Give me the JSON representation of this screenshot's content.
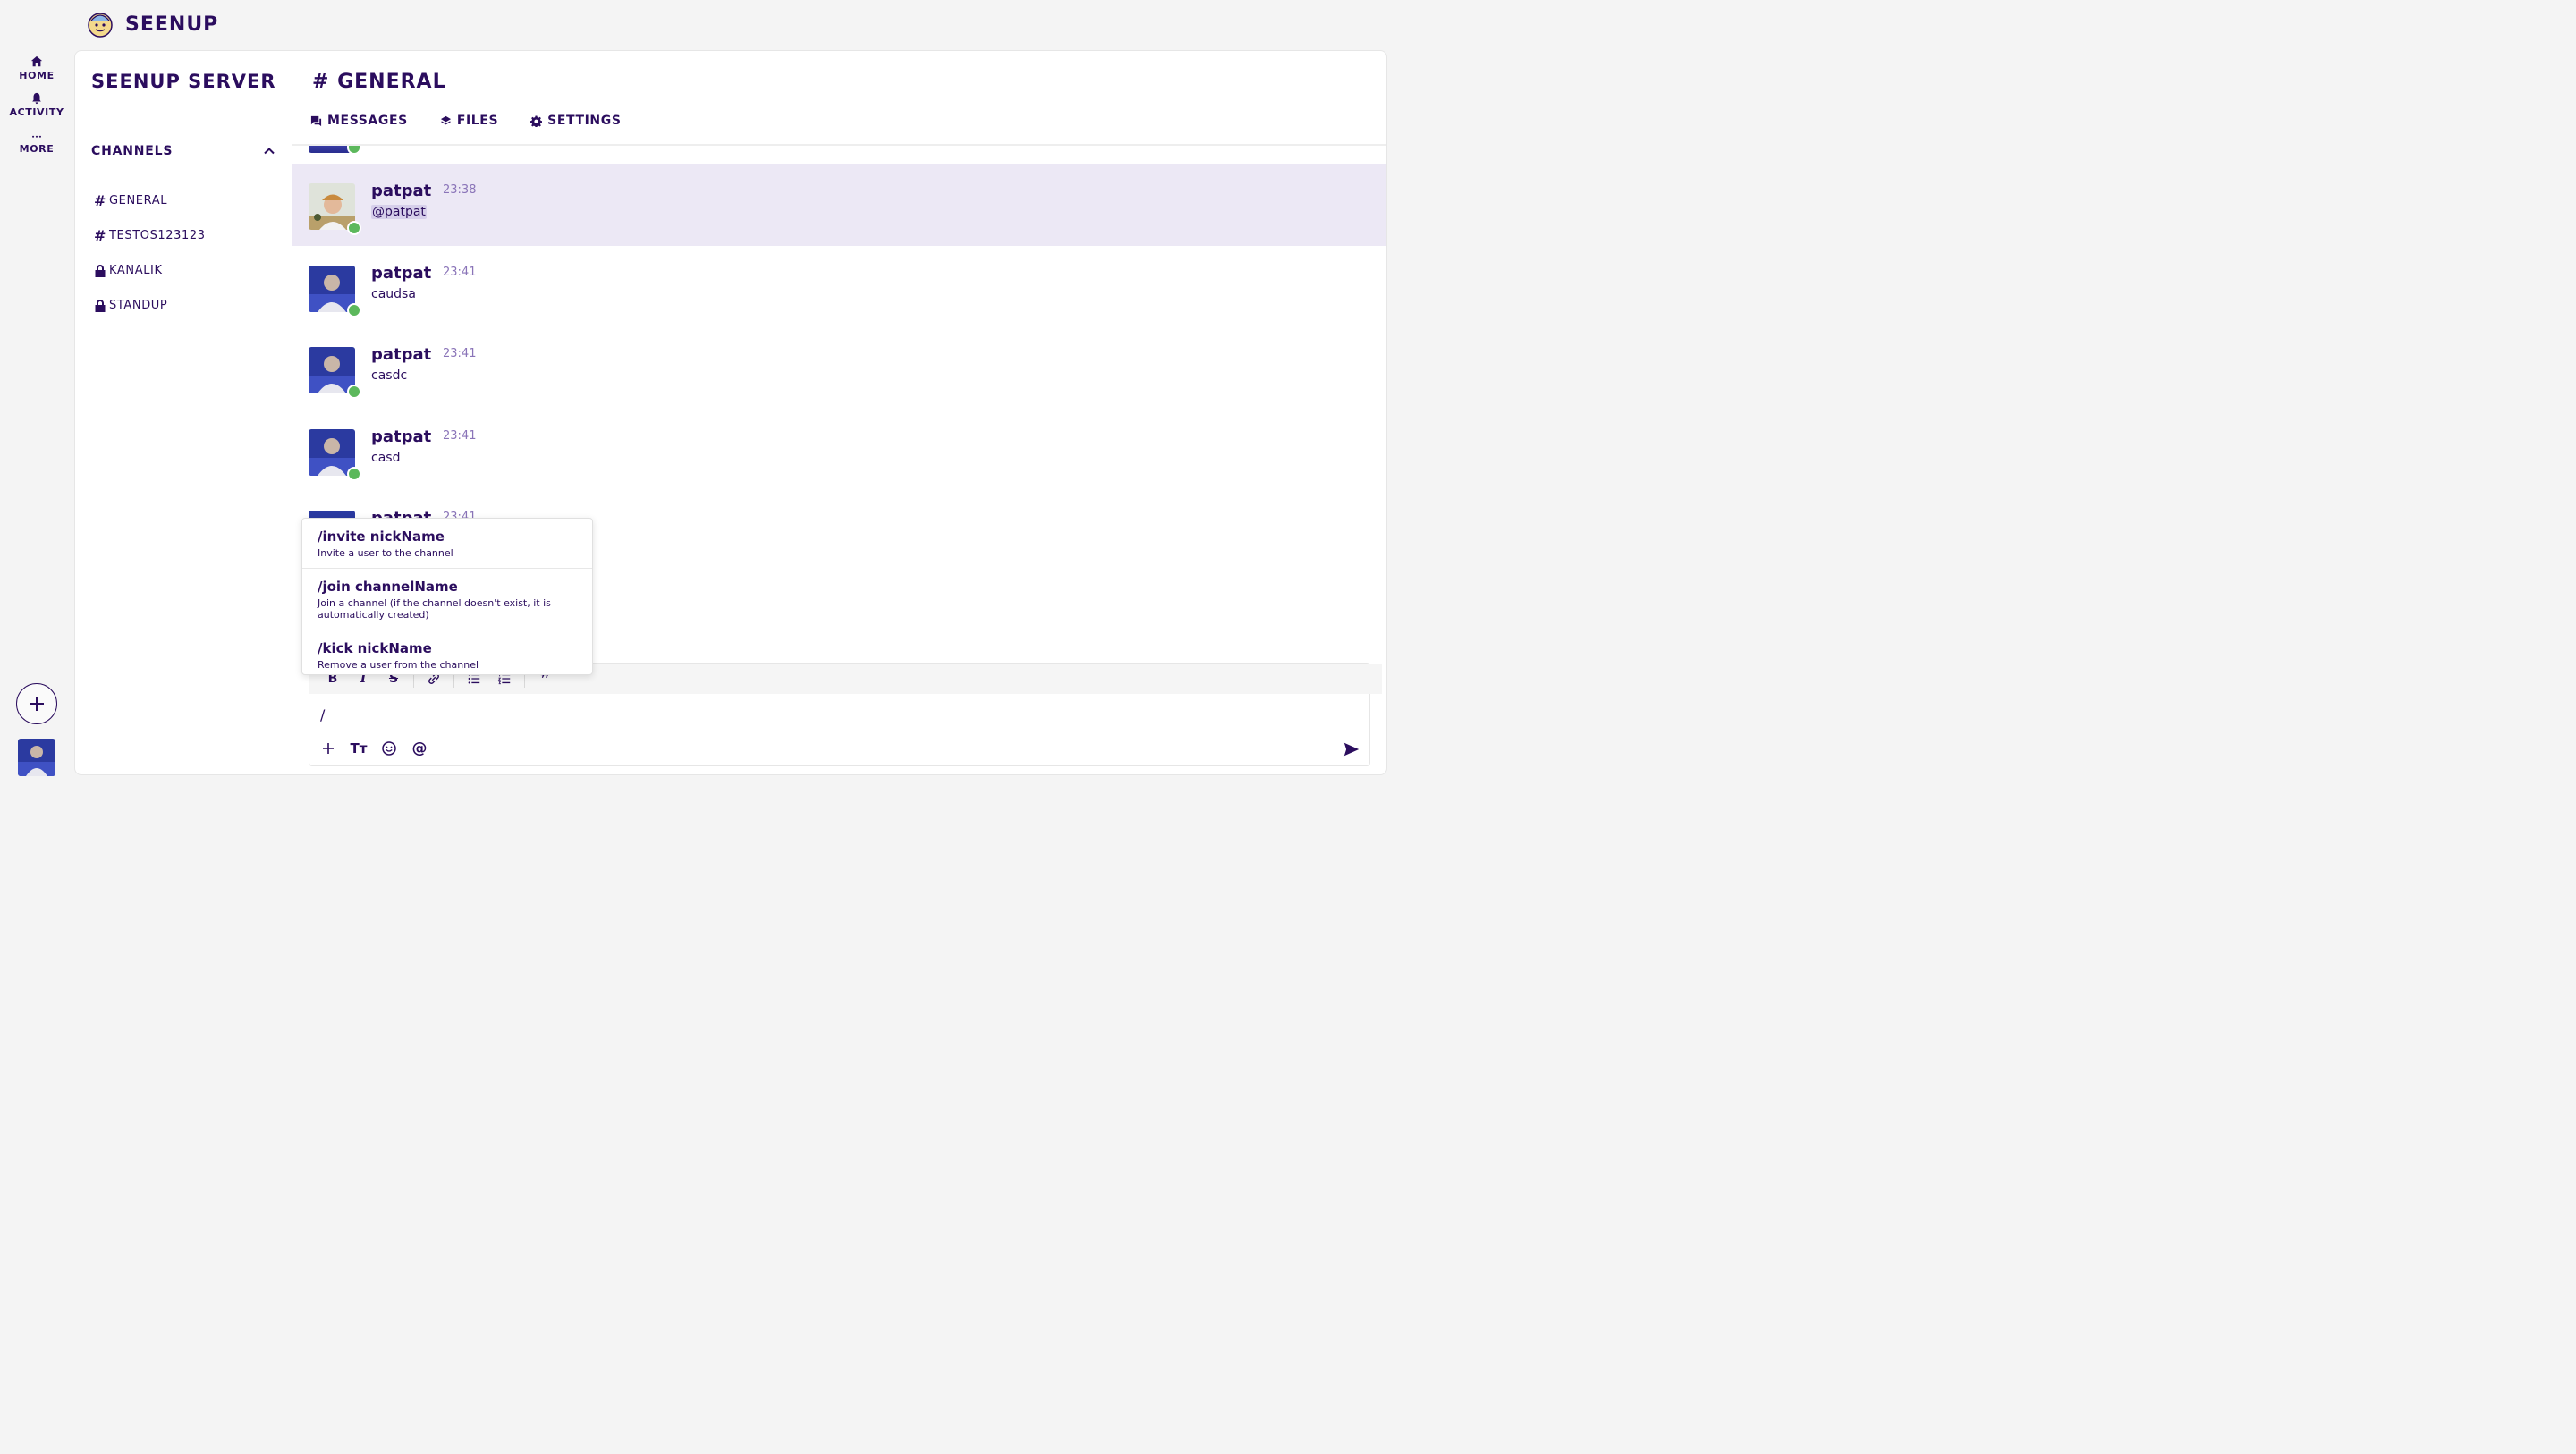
{
  "app": {
    "name": "SEENUP"
  },
  "rail": {
    "items": [
      {
        "label": "HOME",
        "icon": "home-icon"
      },
      {
        "label": "ACTIVITY",
        "icon": "bell-icon"
      },
      {
        "label": "MORE",
        "icon": "ellipsis-icon"
      }
    ]
  },
  "sidebar": {
    "server_name": "SEENUP SERVER",
    "channels_header": "CHANNELS",
    "channels": [
      {
        "name": "GENERAL",
        "type": "public"
      },
      {
        "name": "TESTOS123123",
        "type": "public"
      },
      {
        "name": "KANALIK",
        "type": "private"
      },
      {
        "name": "STANDUP",
        "type": "private"
      }
    ]
  },
  "main": {
    "channel_title": "GENERAL",
    "tabs": [
      {
        "label": "MESSAGES",
        "icon": "message-icon"
      },
      {
        "label": "FILES",
        "icon": "layers-icon"
      },
      {
        "label": "SETTINGS",
        "icon": "gear-icon"
      }
    ],
    "messages": [
      {
        "author": "patpat",
        "time": "23:38",
        "text": "@patpat",
        "highlight": true
      },
      {
        "author": "patpat",
        "time": "23:41",
        "text": "caudsa"
      },
      {
        "author": "patpat",
        "time": "23:41",
        "text": "casdc"
      },
      {
        "author": "patpat",
        "time": "23:41",
        "text": "casd"
      },
      {
        "author": "patpat",
        "time": "23:41",
        "text": ""
      }
    ]
  },
  "suggestions": [
    {
      "command": "/invite nickName",
      "desc": "Invite a user to the channel"
    },
    {
      "command": "/join channelName",
      "desc": "Join a channel (if the channel doesn't exist, it is automatically created)"
    },
    {
      "command": "/kick nickName",
      "desc": "Remove a user from the channel"
    }
  ],
  "composer": {
    "value": "/"
  },
  "colors": {
    "primary": "#2b0d5e",
    "highlight": "#ece8f5",
    "online": "#5cb85c",
    "time": "#8a74b8"
  }
}
